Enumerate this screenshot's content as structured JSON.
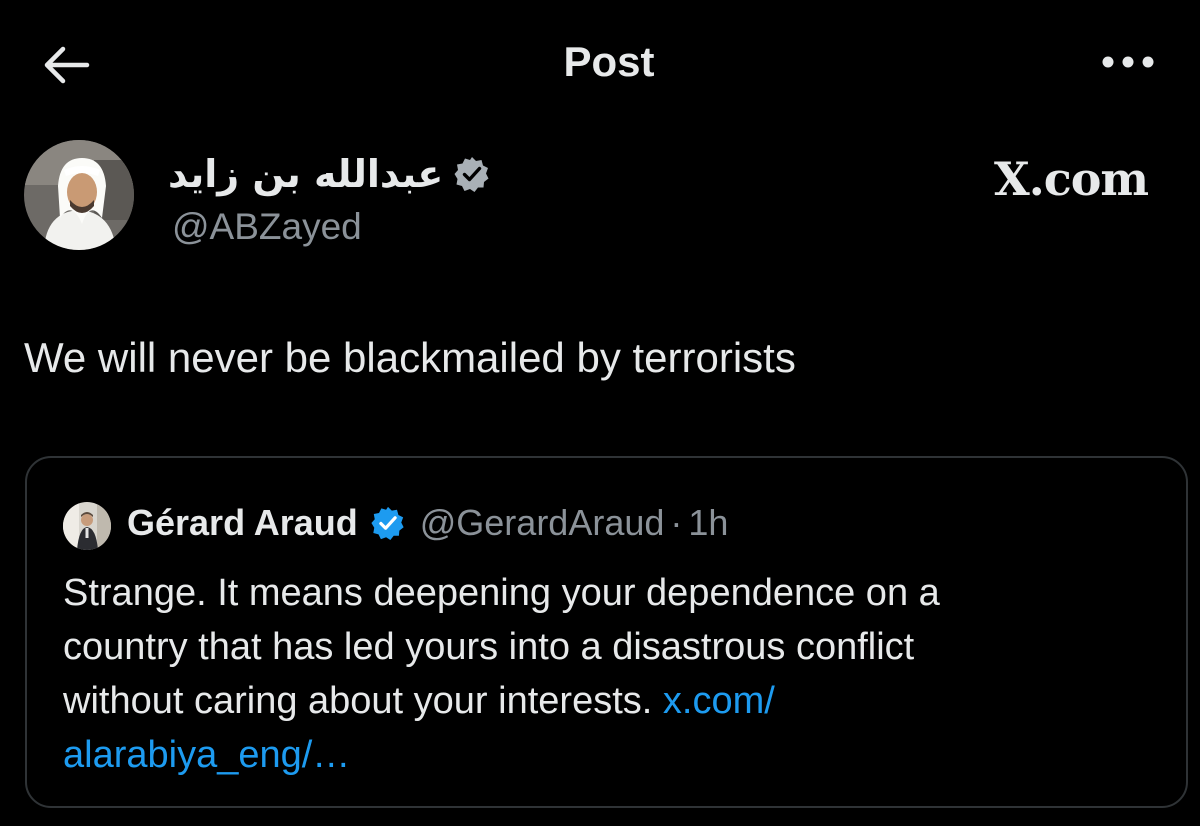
{
  "header": {
    "title": "Post",
    "back_icon": "arrow-left-icon",
    "more_icon": "more-horizontal-icon"
  },
  "author": {
    "name": "عبدالله بن زايد",
    "handle": "@ABZayed",
    "verified": true
  },
  "watermark": "X.com",
  "post": {
    "text": "We will never be blackmailed by terrorists"
  },
  "quoted_post": {
    "author_name": "Gérard Araud",
    "handle": "@GerardAraud",
    "separator": "·",
    "time": "1h",
    "verified": true,
    "text_line1": "Strange. It means deepening your dependence on a",
    "text_line2": "country that has led yours into a disastrous conflict",
    "text_line3": "without caring about your interests.",
    "link_part1": "x.com/",
    "link_part2": "alarabiya_eng/…"
  },
  "colors": {
    "background": "#000000",
    "text": "#e7e9ea",
    "secondary": "#8b9299",
    "link": "#1d9bf0",
    "verified_badge": "#a9b0b6",
    "quote_verified_badge": "#1d9bf0",
    "border": "#2f3336"
  }
}
